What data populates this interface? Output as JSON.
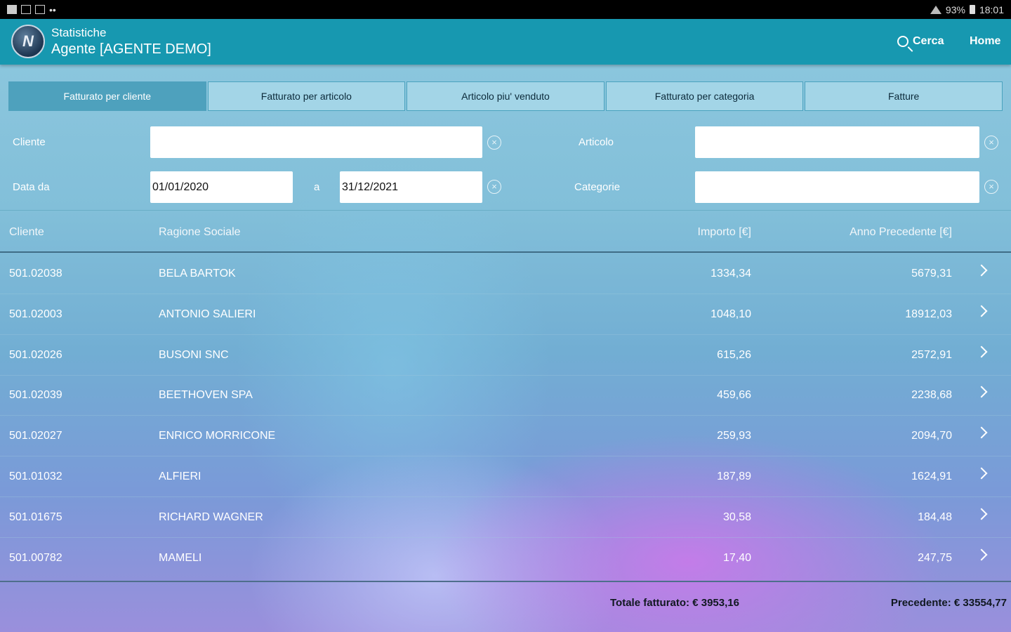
{
  "status_bar": {
    "battery": "93%",
    "time": "18:01"
  },
  "app_bar": {
    "title": "Statistiche",
    "subtitle": "Agente [AGENTE DEMO]",
    "search_label": "Cerca",
    "home_label": "Home"
  },
  "tabs": [
    {
      "label": "Fatturato per cliente",
      "active": true
    },
    {
      "label": "Fatturato per articolo",
      "active": false
    },
    {
      "label": "Articolo piu' venduto",
      "active": false
    },
    {
      "label": "Fatturato per categoria",
      "active": false
    },
    {
      "label": "Fatture",
      "active": false
    }
  ],
  "filters": {
    "cliente_label": "Cliente",
    "cliente_value": "",
    "articolo_label": "Articolo",
    "articolo_value": "",
    "data_da_label": "Data da",
    "data_da_value": "01/01/2020",
    "a_label": "a",
    "data_a_value": "31/12/2021",
    "categorie_label": "Categorie",
    "categorie_value": ""
  },
  "table": {
    "headers": {
      "cliente": "Cliente",
      "ragione_sociale": "Ragione Sociale",
      "importo": "Importo [€]",
      "anno_precedente": "Anno Precedente [€]"
    },
    "rows": [
      {
        "cliente": "501.02038",
        "ragione_sociale": "BELA BARTOK",
        "importo": "1334,34",
        "anno_precedente": "5679,31"
      },
      {
        "cliente": "501.02003",
        "ragione_sociale": "ANTONIO SALIERI",
        "importo": "1048,10",
        "anno_precedente": "18912,03"
      },
      {
        "cliente": "501.02026",
        "ragione_sociale": "BUSONI SNC",
        "importo": "615,26",
        "anno_precedente": "2572,91"
      },
      {
        "cliente": "501.02039",
        "ragione_sociale": "BEETHOVEN SPA",
        "importo": "459,66",
        "anno_precedente": "2238,68"
      },
      {
        "cliente": "501.02027",
        "ragione_sociale": "ENRICO MORRICONE",
        "importo": "259,93",
        "anno_precedente": "2094,70"
      },
      {
        "cliente": "501.01032",
        "ragione_sociale": "ALFIERI",
        "importo": "187,89",
        "anno_precedente": "1624,91"
      },
      {
        "cliente": "501.01675",
        "ragione_sociale": "RICHARD WAGNER",
        "importo": "30,58",
        "anno_precedente": "184,48"
      },
      {
        "cliente": "501.00782",
        "ragione_sociale": "MAMELI",
        "importo": "17,40",
        "anno_precedente": "247,75"
      }
    ]
  },
  "footer": {
    "totale": "Totale fatturato: € 3953,16",
    "precedente": "Precedente: € 33554,77"
  }
}
